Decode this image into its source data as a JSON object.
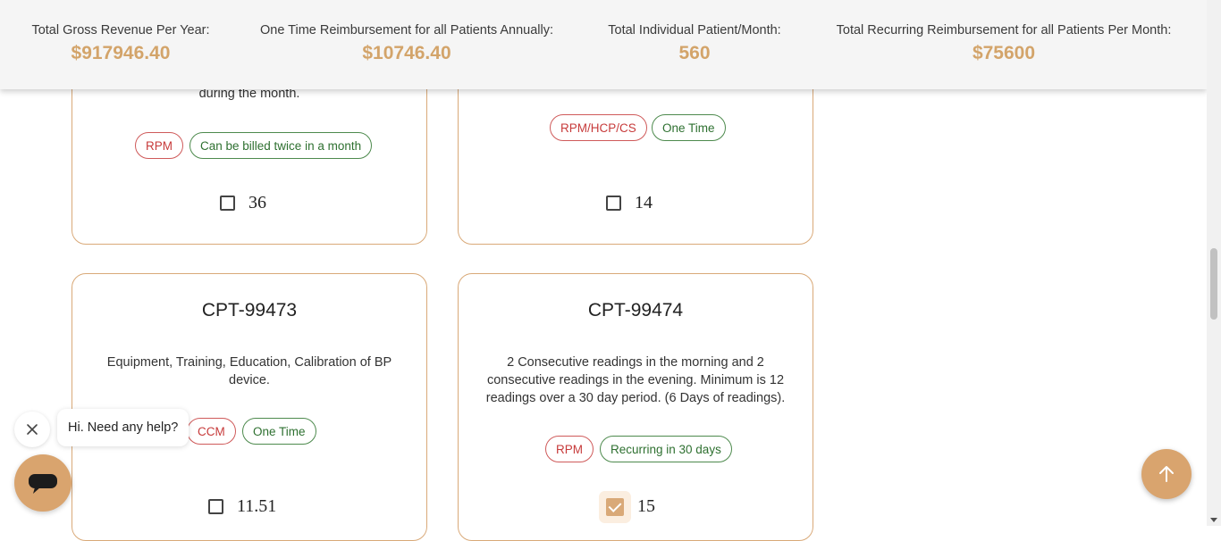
{
  "summary": {
    "gross_label": "Total Gross Revenue Per Year:",
    "gross_value": "$917946.40",
    "onetime_label": "One Time Reimbursement for all Patients Annually:",
    "onetime_value": "$10746.40",
    "patients_label": "Total Individual Patient/Month:",
    "patients_value": "560",
    "recurring_label": "Total Recurring Reimbursement for all Patients Per Month:",
    "recurring_value": "$75600"
  },
  "cards": [
    {
      "title": "",
      "desc": "during the month.",
      "tags": [
        "RPM",
        "Can be billed twice in a month"
      ],
      "checked": false,
      "price": "36"
    },
    {
      "title": "",
      "desc": "",
      "tags": [
        "RPM/HCP/CS",
        "One Time"
      ],
      "checked": false,
      "price": "14"
    },
    {
      "title": "CPT-99473",
      "desc": "Equipment, Training, Education, Calibration of BP device.",
      "tags": [
        "CCM",
        "One Time"
      ],
      "checked": false,
      "price": "11.51"
    },
    {
      "title": "CPT-99474",
      "desc": "2 Consecutive readings in the morning and 2 consecutive readings in the evening. Minimum is 12 readings over a 30 day period. (6 Days of readings).",
      "tags": [
        "RPM",
        "Recurring in 30 days"
      ],
      "checked": true,
      "price": "15"
    }
  ],
  "chat": {
    "greeting": "Hi. Need any help?"
  },
  "icons": {
    "close": "close-icon",
    "chat": "chat-icon",
    "back_to_top": "arrow-up-icon"
  },
  "colors": {
    "accent": "#d9a46e",
    "value_text": "#d3a46a",
    "tag_red": "#c73b3b",
    "tag_green": "#2e7030"
  }
}
